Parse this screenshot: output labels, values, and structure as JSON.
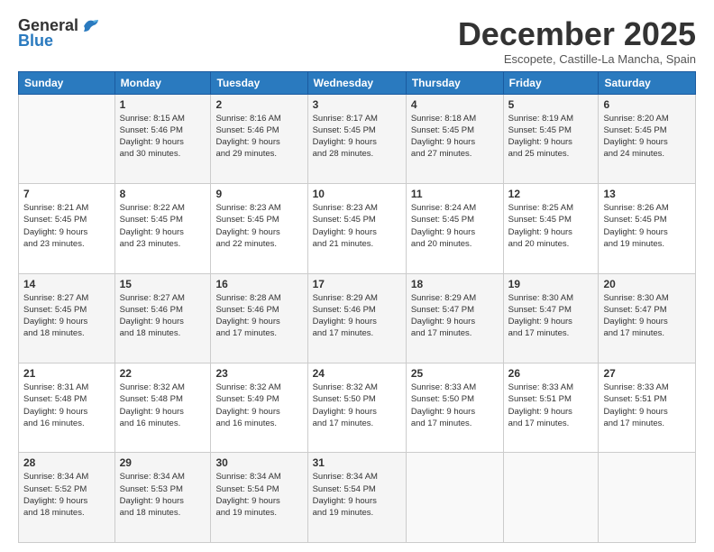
{
  "app": {
    "logo_general": "General",
    "logo_blue": "Blue"
  },
  "header": {
    "month": "December 2025",
    "location": "Escopete, Castille-La Mancha, Spain"
  },
  "weekdays": [
    "Sunday",
    "Monday",
    "Tuesday",
    "Wednesday",
    "Thursday",
    "Friday",
    "Saturday"
  ],
  "weeks": [
    [
      {
        "day": "",
        "info": ""
      },
      {
        "day": "1",
        "info": "Sunrise: 8:15 AM\nSunset: 5:46 PM\nDaylight: 9 hours\nand 30 minutes."
      },
      {
        "day": "2",
        "info": "Sunrise: 8:16 AM\nSunset: 5:46 PM\nDaylight: 9 hours\nand 29 minutes."
      },
      {
        "day": "3",
        "info": "Sunrise: 8:17 AM\nSunset: 5:45 PM\nDaylight: 9 hours\nand 28 minutes."
      },
      {
        "day": "4",
        "info": "Sunrise: 8:18 AM\nSunset: 5:45 PM\nDaylight: 9 hours\nand 27 minutes."
      },
      {
        "day": "5",
        "info": "Sunrise: 8:19 AM\nSunset: 5:45 PM\nDaylight: 9 hours\nand 25 minutes."
      },
      {
        "day": "6",
        "info": "Sunrise: 8:20 AM\nSunset: 5:45 PM\nDaylight: 9 hours\nand 24 minutes."
      }
    ],
    [
      {
        "day": "7",
        "info": "Sunrise: 8:21 AM\nSunset: 5:45 PM\nDaylight: 9 hours\nand 23 minutes."
      },
      {
        "day": "8",
        "info": "Sunrise: 8:22 AM\nSunset: 5:45 PM\nDaylight: 9 hours\nand 23 minutes."
      },
      {
        "day": "9",
        "info": "Sunrise: 8:23 AM\nSunset: 5:45 PM\nDaylight: 9 hours\nand 22 minutes."
      },
      {
        "day": "10",
        "info": "Sunrise: 8:23 AM\nSunset: 5:45 PM\nDaylight: 9 hours\nand 21 minutes."
      },
      {
        "day": "11",
        "info": "Sunrise: 8:24 AM\nSunset: 5:45 PM\nDaylight: 9 hours\nand 20 minutes."
      },
      {
        "day": "12",
        "info": "Sunrise: 8:25 AM\nSunset: 5:45 PM\nDaylight: 9 hours\nand 20 minutes."
      },
      {
        "day": "13",
        "info": "Sunrise: 8:26 AM\nSunset: 5:45 PM\nDaylight: 9 hours\nand 19 minutes."
      }
    ],
    [
      {
        "day": "14",
        "info": "Sunrise: 8:27 AM\nSunset: 5:45 PM\nDaylight: 9 hours\nand 18 minutes."
      },
      {
        "day": "15",
        "info": "Sunrise: 8:27 AM\nSunset: 5:46 PM\nDaylight: 9 hours\nand 18 minutes."
      },
      {
        "day": "16",
        "info": "Sunrise: 8:28 AM\nSunset: 5:46 PM\nDaylight: 9 hours\nand 17 minutes."
      },
      {
        "day": "17",
        "info": "Sunrise: 8:29 AM\nSunset: 5:46 PM\nDaylight: 9 hours\nand 17 minutes."
      },
      {
        "day": "18",
        "info": "Sunrise: 8:29 AM\nSunset: 5:47 PM\nDaylight: 9 hours\nand 17 minutes."
      },
      {
        "day": "19",
        "info": "Sunrise: 8:30 AM\nSunset: 5:47 PM\nDaylight: 9 hours\nand 17 minutes."
      },
      {
        "day": "20",
        "info": "Sunrise: 8:30 AM\nSunset: 5:47 PM\nDaylight: 9 hours\nand 17 minutes."
      }
    ],
    [
      {
        "day": "21",
        "info": "Sunrise: 8:31 AM\nSunset: 5:48 PM\nDaylight: 9 hours\nand 16 minutes."
      },
      {
        "day": "22",
        "info": "Sunrise: 8:32 AM\nSunset: 5:48 PM\nDaylight: 9 hours\nand 16 minutes."
      },
      {
        "day": "23",
        "info": "Sunrise: 8:32 AM\nSunset: 5:49 PM\nDaylight: 9 hours\nand 16 minutes."
      },
      {
        "day": "24",
        "info": "Sunrise: 8:32 AM\nSunset: 5:50 PM\nDaylight: 9 hours\nand 17 minutes."
      },
      {
        "day": "25",
        "info": "Sunrise: 8:33 AM\nSunset: 5:50 PM\nDaylight: 9 hours\nand 17 minutes."
      },
      {
        "day": "26",
        "info": "Sunrise: 8:33 AM\nSunset: 5:51 PM\nDaylight: 9 hours\nand 17 minutes."
      },
      {
        "day": "27",
        "info": "Sunrise: 8:33 AM\nSunset: 5:51 PM\nDaylight: 9 hours\nand 17 minutes."
      }
    ],
    [
      {
        "day": "28",
        "info": "Sunrise: 8:34 AM\nSunset: 5:52 PM\nDaylight: 9 hours\nand 18 minutes."
      },
      {
        "day": "29",
        "info": "Sunrise: 8:34 AM\nSunset: 5:53 PM\nDaylight: 9 hours\nand 18 minutes."
      },
      {
        "day": "30",
        "info": "Sunrise: 8:34 AM\nSunset: 5:54 PM\nDaylight: 9 hours\nand 19 minutes."
      },
      {
        "day": "31",
        "info": "Sunrise: 8:34 AM\nSunset: 5:54 PM\nDaylight: 9 hours\nand 19 minutes."
      },
      {
        "day": "",
        "info": ""
      },
      {
        "day": "",
        "info": ""
      },
      {
        "day": "",
        "info": ""
      }
    ]
  ]
}
